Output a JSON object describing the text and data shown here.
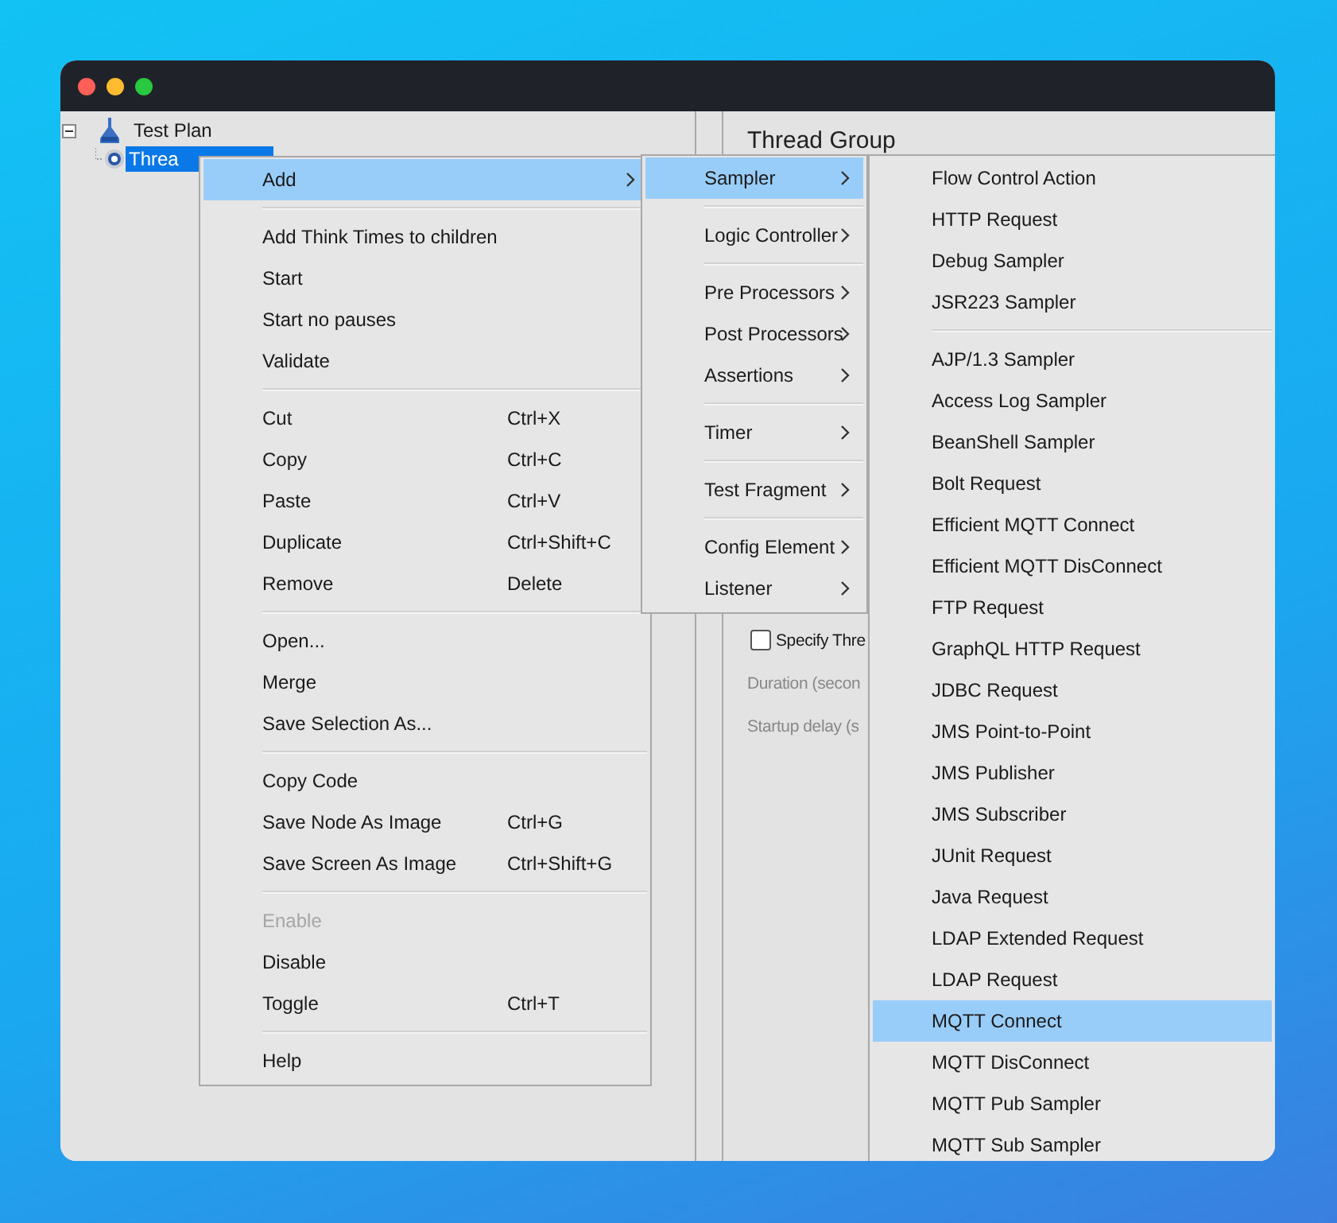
{
  "tree": {
    "items": [
      {
        "label": "Test Plan",
        "expanded": true,
        "selected": false,
        "children": [
          {
            "label": "Threa",
            "selected": true
          }
        ]
      }
    ]
  },
  "panel": {
    "title": "Thread Group",
    "fields": [
      {
        "kind": "checkbox",
        "label": "Specify Thre",
        "checked": false,
        "disabled": false
      },
      {
        "kind": "label",
        "label": "Duration (secon",
        "disabled": true
      },
      {
        "kind": "label",
        "label": "Startup delay (s",
        "disabled": true
      }
    ]
  },
  "context_menu": {
    "items": [
      {
        "kind": "item",
        "label": "Add",
        "submenu": true,
        "selected": true,
        "disabled": false
      },
      {
        "kind": "separator"
      },
      {
        "kind": "item",
        "label": "Add Think Times to children",
        "selected": false,
        "disabled": false
      },
      {
        "kind": "item",
        "label": "Start",
        "selected": false,
        "disabled": false
      },
      {
        "kind": "item",
        "label": "Start no pauses",
        "selected": false,
        "disabled": false
      },
      {
        "kind": "item",
        "label": "Validate",
        "selected": false,
        "disabled": false
      },
      {
        "kind": "separator"
      },
      {
        "kind": "item",
        "label": "Cut",
        "shortcut": "Ctrl+X",
        "selected": false,
        "disabled": false
      },
      {
        "kind": "item",
        "label": "Copy",
        "shortcut": "Ctrl+C",
        "selected": false,
        "disabled": false
      },
      {
        "kind": "item",
        "label": "Paste",
        "shortcut": "Ctrl+V",
        "selected": false,
        "disabled": false
      },
      {
        "kind": "item",
        "label": "Duplicate",
        "shortcut": "Ctrl+Shift+C",
        "selected": false,
        "disabled": false
      },
      {
        "kind": "item",
        "label": "Remove",
        "shortcut": "Delete",
        "selected": false,
        "disabled": false
      },
      {
        "kind": "separator"
      },
      {
        "kind": "item",
        "label": "Open...",
        "selected": false,
        "disabled": false
      },
      {
        "kind": "item",
        "label": "Merge",
        "selected": false,
        "disabled": false
      },
      {
        "kind": "item",
        "label": "Save Selection As...",
        "selected": false,
        "disabled": false
      },
      {
        "kind": "separator"
      },
      {
        "kind": "item",
        "label": "Copy Code",
        "selected": false,
        "disabled": false
      },
      {
        "kind": "item",
        "label": "Save Node As Image",
        "shortcut": "Ctrl+G",
        "selected": false,
        "disabled": false
      },
      {
        "kind": "item",
        "label": "Save Screen As Image",
        "shortcut": "Ctrl+Shift+G",
        "selected": false,
        "disabled": false
      },
      {
        "kind": "separator"
      },
      {
        "kind": "item",
        "label": "Enable",
        "selected": false,
        "disabled": true
      },
      {
        "kind": "item",
        "label": "Disable",
        "selected": false,
        "disabled": false
      },
      {
        "kind": "item",
        "label": "Toggle",
        "shortcut": "Ctrl+T",
        "selected": false,
        "disabled": false
      },
      {
        "kind": "separator"
      },
      {
        "kind": "item",
        "label": "Help",
        "selected": false,
        "disabled": false
      }
    ]
  },
  "add_submenu": {
    "items": [
      {
        "kind": "item",
        "label": "Sampler",
        "submenu": true,
        "selected": true,
        "disabled": false
      },
      {
        "kind": "separator"
      },
      {
        "kind": "item",
        "label": "Logic Controller",
        "submenu": true,
        "selected": false,
        "disabled": false
      },
      {
        "kind": "separator"
      },
      {
        "kind": "item",
        "label": "Pre Processors",
        "submenu": true,
        "selected": false,
        "disabled": false
      },
      {
        "kind": "item",
        "label": "Post Processors",
        "submenu": true,
        "selected": false,
        "disabled": false
      },
      {
        "kind": "item",
        "label": "Assertions",
        "submenu": true,
        "selected": false,
        "disabled": false
      },
      {
        "kind": "separator"
      },
      {
        "kind": "item",
        "label": "Timer",
        "submenu": true,
        "selected": false,
        "disabled": false
      },
      {
        "kind": "separator"
      },
      {
        "kind": "item",
        "label": "Test Fragment",
        "submenu": true,
        "selected": false,
        "disabled": false
      },
      {
        "kind": "separator"
      },
      {
        "kind": "item",
        "label": "Config Element",
        "submenu": true,
        "selected": false,
        "disabled": false
      },
      {
        "kind": "item",
        "label": "Listener",
        "submenu": true,
        "selected": false,
        "disabled": false
      }
    ]
  },
  "sampler_submenu": {
    "items": [
      {
        "kind": "item",
        "label": "Flow Control Action",
        "selected": false,
        "disabled": false
      },
      {
        "kind": "item",
        "label": "HTTP Request",
        "selected": false,
        "disabled": false
      },
      {
        "kind": "item",
        "label": "Debug Sampler",
        "selected": false,
        "disabled": false
      },
      {
        "kind": "item",
        "label": "JSR223 Sampler",
        "selected": false,
        "disabled": false
      },
      {
        "kind": "separator"
      },
      {
        "kind": "item",
        "label": "AJP/1.3 Sampler",
        "selected": false,
        "disabled": false
      },
      {
        "kind": "item",
        "label": "Access Log Sampler",
        "selected": false,
        "disabled": false
      },
      {
        "kind": "item",
        "label": "BeanShell Sampler",
        "selected": false,
        "disabled": false
      },
      {
        "kind": "item",
        "label": "Bolt Request",
        "selected": false,
        "disabled": false
      },
      {
        "kind": "item",
        "label": "Efficient MQTT Connect",
        "selected": false,
        "disabled": false
      },
      {
        "kind": "item",
        "label": "Efficient MQTT DisConnect",
        "selected": false,
        "disabled": false
      },
      {
        "kind": "item",
        "label": "FTP Request",
        "selected": false,
        "disabled": false
      },
      {
        "kind": "item",
        "label": "GraphQL HTTP Request",
        "selected": false,
        "disabled": false
      },
      {
        "kind": "item",
        "label": "JDBC Request",
        "selected": false,
        "disabled": false
      },
      {
        "kind": "item",
        "label": "JMS Point-to-Point",
        "selected": false,
        "disabled": false
      },
      {
        "kind": "item",
        "label": "JMS Publisher",
        "selected": false,
        "disabled": false
      },
      {
        "kind": "item",
        "label": "JMS Subscriber",
        "selected": false,
        "disabled": false
      },
      {
        "kind": "item",
        "label": "JUnit Request",
        "selected": false,
        "disabled": false
      },
      {
        "kind": "item",
        "label": "Java Request",
        "selected": false,
        "disabled": false
      },
      {
        "kind": "item",
        "label": "LDAP Extended Request",
        "selected": false,
        "disabled": false
      },
      {
        "kind": "item",
        "label": "LDAP Request",
        "selected": false,
        "disabled": false
      },
      {
        "kind": "item",
        "label": "MQTT Connect",
        "selected": true,
        "disabled": false
      },
      {
        "kind": "item",
        "label": "MQTT DisConnect",
        "selected": false,
        "disabled": false
      },
      {
        "kind": "item",
        "label": "MQTT Pub Sampler",
        "selected": false,
        "disabled": false
      },
      {
        "kind": "item",
        "label": "MQTT Sub Sampler",
        "selected": false,
        "disabled": false
      }
    ]
  }
}
